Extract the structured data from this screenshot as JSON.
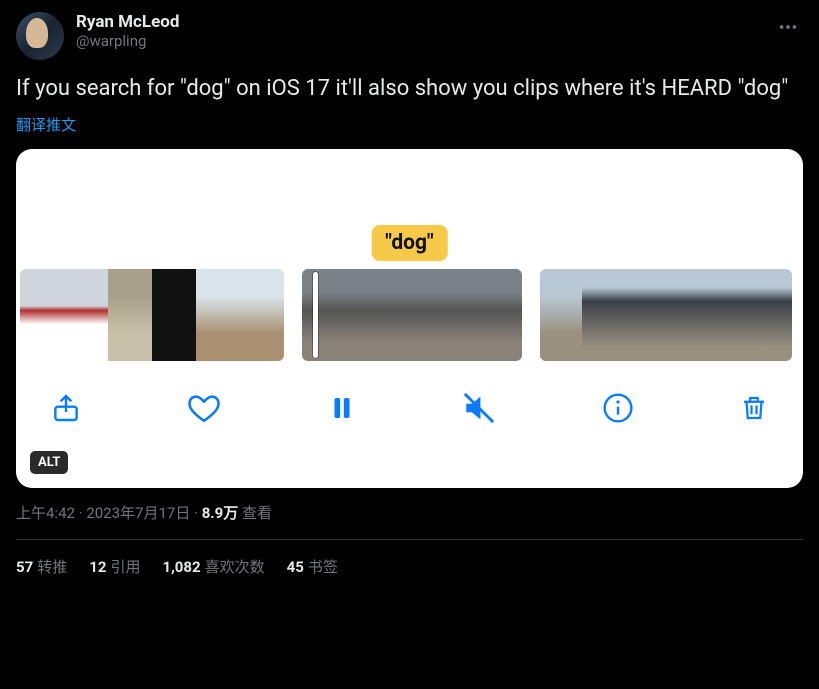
{
  "author": {
    "display_name": "Ryan McLeod",
    "handle": "@warpling"
  },
  "tweet_text": "If you search for \"dog\" on iOS 17 it'll also show you clips where it's HEARD \"dog\"",
  "translate_label": "翻译推文",
  "media": {
    "caption_word": "\"dog\"",
    "alt_badge": "ALT"
  },
  "meta": {
    "time": "上午4:42",
    "date": "2023年7月17日",
    "views_count": "8.9万",
    "views_label": "查看"
  },
  "stats": {
    "retweets": {
      "count": "57",
      "label": "转推"
    },
    "quotes": {
      "count": "12",
      "label": "引用"
    },
    "likes": {
      "count": "1,082",
      "label": "喜欢次数"
    },
    "bookmarks": {
      "count": "45",
      "label": "书签"
    }
  }
}
